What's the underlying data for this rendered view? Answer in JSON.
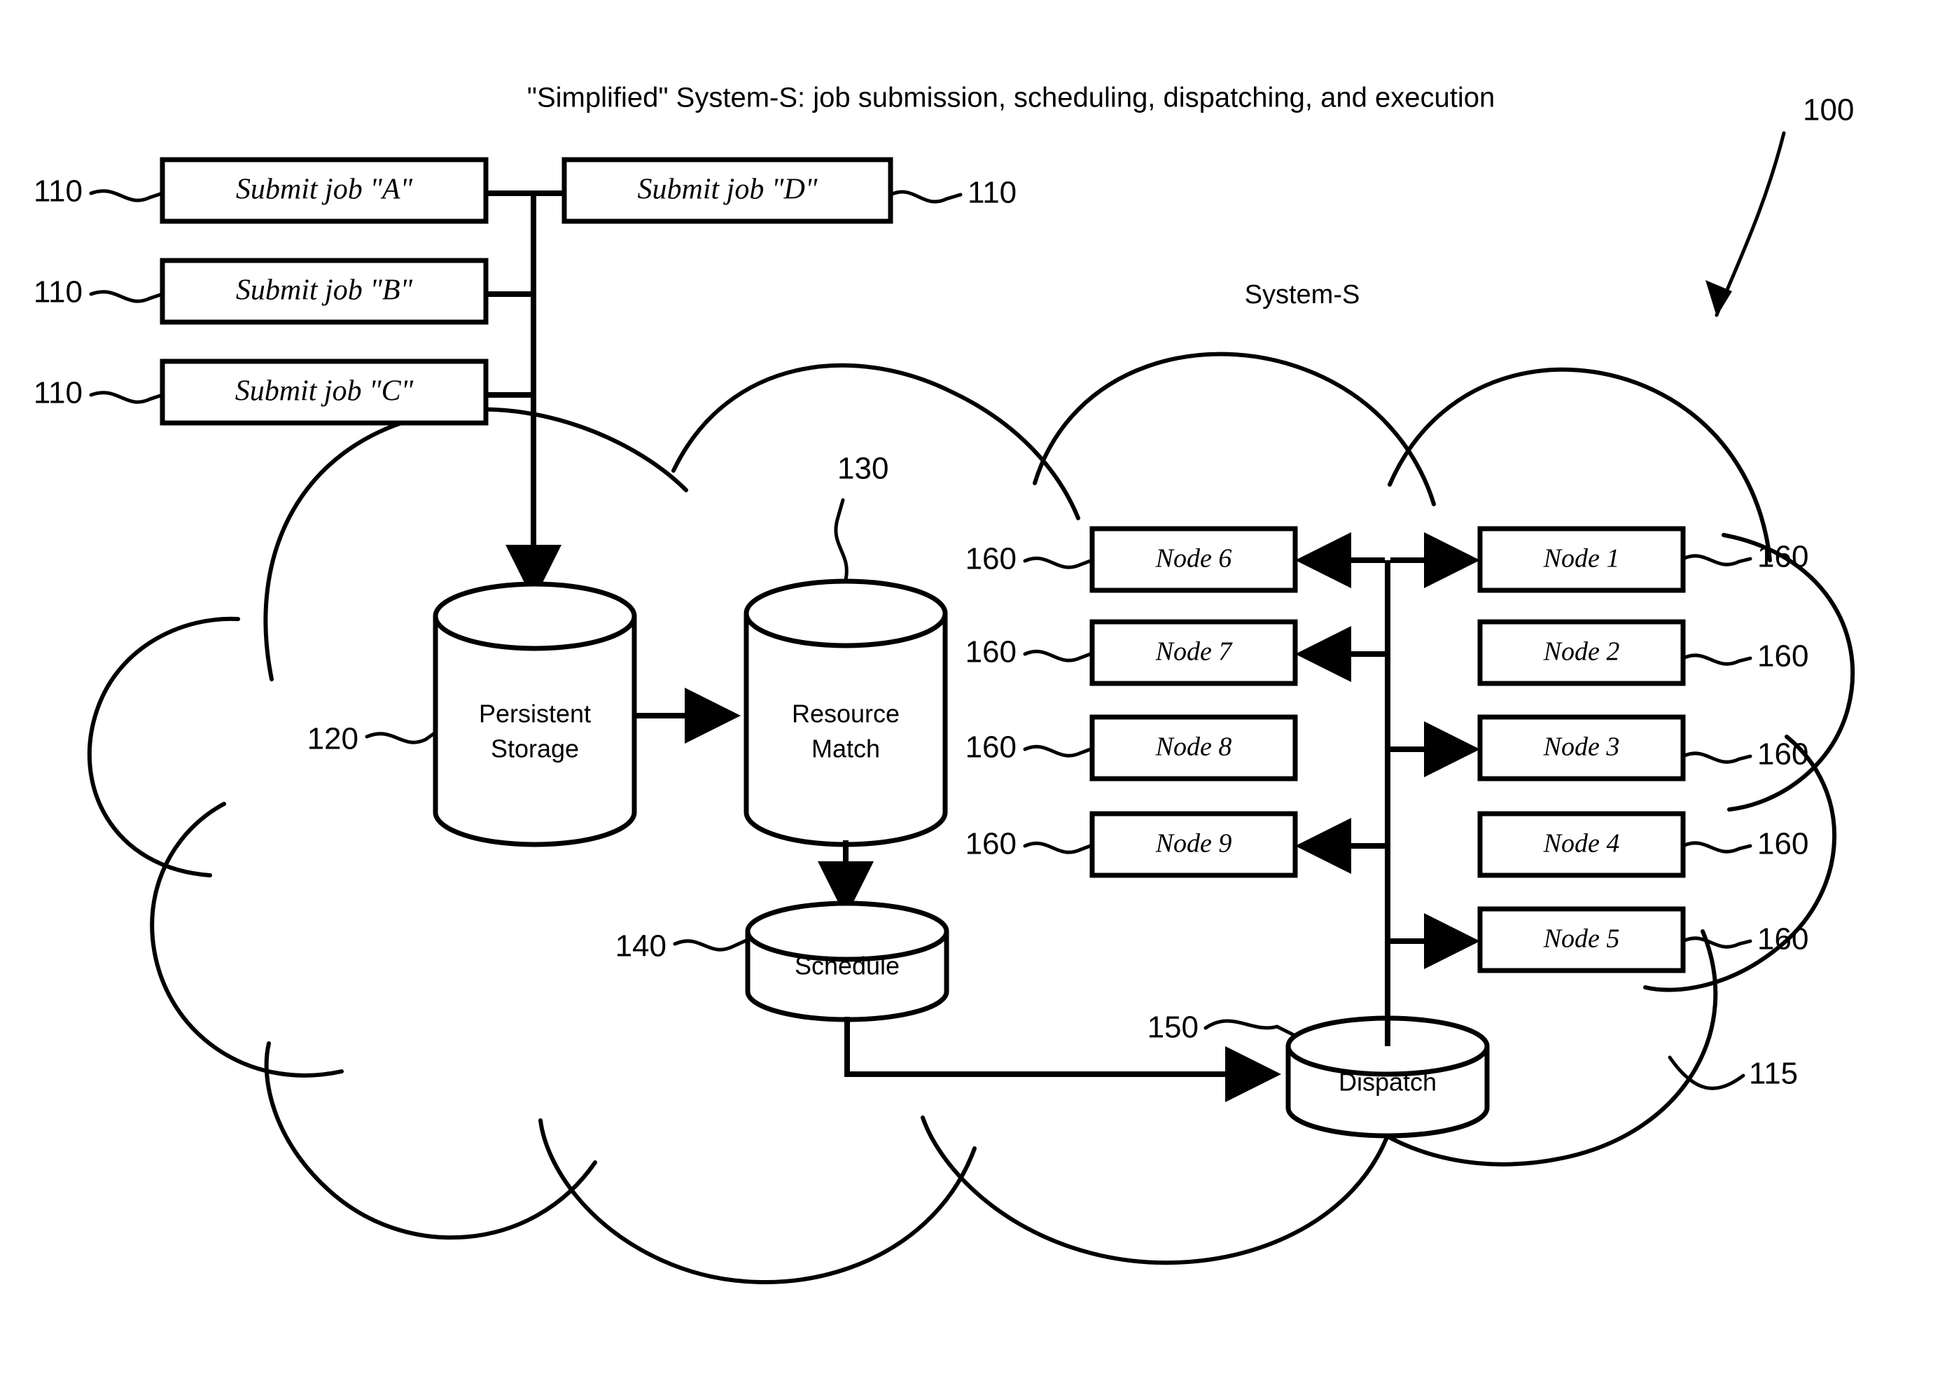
{
  "figure": {
    "title": "\"Simplified\" System-S: job submission, scheduling, dispatching, and execution",
    "system_label": "System-S",
    "figure_ref": "100",
    "cloud_ref": "115"
  },
  "submit_boxes": [
    {
      "label": "Submit job \"A\"",
      "ref": "110"
    },
    {
      "label": "Submit job \"B\"",
      "ref": "110"
    },
    {
      "label": "Submit job \"C\"",
      "ref": "110"
    },
    {
      "label": "Submit job \"D\"",
      "ref": "110"
    }
  ],
  "stages": [
    {
      "name": "Persistent Storage",
      "line1": "Persistent",
      "line2": "Storage",
      "ref": "120"
    },
    {
      "name": "Resource Match",
      "line1": "Resource",
      "line2": "Match",
      "ref": "130"
    },
    {
      "name": "Schedule",
      "line1": "Schedule",
      "line2": "",
      "ref": "140"
    },
    {
      "name": "Dispatch",
      "line1": "Dispatch",
      "line2": "",
      "ref": "150"
    }
  ],
  "nodes_right": [
    {
      "label": "Node 1",
      "ref": "160"
    },
    {
      "label": "Node 2",
      "ref": "160"
    },
    {
      "label": "Node 3",
      "ref": "160"
    },
    {
      "label": "Node 4",
      "ref": "160"
    },
    {
      "label": "Node 5",
      "ref": "160"
    }
  ],
  "nodes_left": [
    {
      "label": "Node 6",
      "ref": "160"
    },
    {
      "label": "Node 7",
      "ref": "160"
    },
    {
      "label": "Node 8",
      "ref": "160"
    },
    {
      "label": "Node 9",
      "ref": "160"
    }
  ],
  "colors": {
    "ink": "#000000",
    "paper": "#ffffff"
  }
}
